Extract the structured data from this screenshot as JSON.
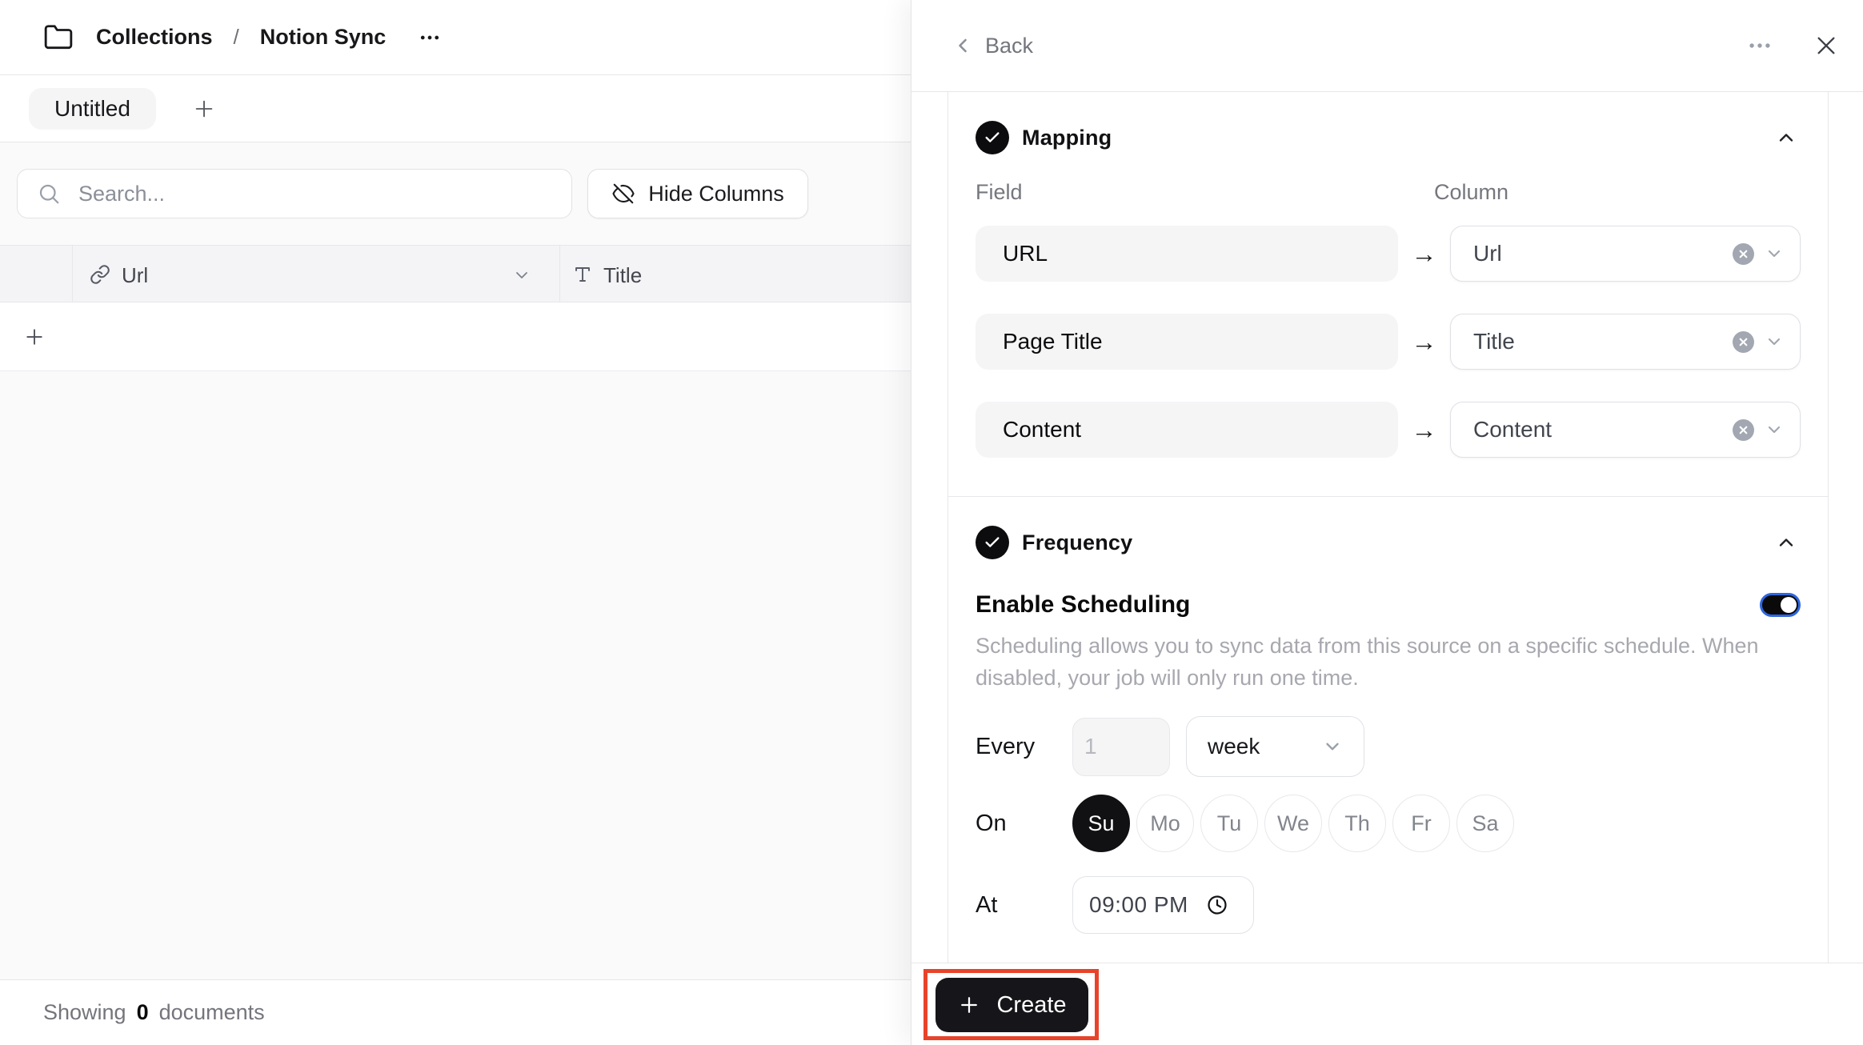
{
  "breadcrumb": {
    "root": "Collections",
    "separator": "/",
    "current": "Notion Sync"
  },
  "tabs": {
    "active": "Untitled"
  },
  "toolbar": {
    "search_placeholder": "Search...",
    "hide_columns_label": "Hide Columns"
  },
  "table": {
    "columns": [
      {
        "label": "Url",
        "icon": "link-icon"
      },
      {
        "label": "Title",
        "icon": "type-icon"
      }
    ],
    "rows": [],
    "footer": {
      "prefix": "Showing",
      "count": "0",
      "suffix": "documents"
    }
  },
  "panel": {
    "back_label": "Back",
    "mapping": {
      "title": "Mapping",
      "field_header": "Field",
      "column_header": "Column",
      "arrow": "→",
      "rows": [
        {
          "field": "URL",
          "column": "Url"
        },
        {
          "field": "Page Title",
          "column": "Title"
        },
        {
          "field": "Content",
          "column": "Content"
        }
      ]
    },
    "frequency": {
      "title": "Frequency",
      "enable_label": "Enable Scheduling",
      "enabled": true,
      "description": "Scheduling allows you to sync data from this source on a specific schedule. When disabled, your job will only run one time.",
      "every_label": "Every",
      "interval_value": "1",
      "unit_value": "week",
      "on_label": "On",
      "days": [
        {
          "label": "Su",
          "selected": true
        },
        {
          "label": "Mo",
          "selected": false
        },
        {
          "label": "Tu",
          "selected": false
        },
        {
          "label": "We",
          "selected": false
        },
        {
          "label": "Th",
          "selected": false
        },
        {
          "label": "Fr",
          "selected": false
        },
        {
          "label": "Sa",
          "selected": false
        }
      ],
      "at_label": "At",
      "time_value": "09:00 PM"
    },
    "create_label": "Create"
  },
  "colors": {
    "annotation_red": "#e8432a",
    "toggle_ring_blue": "#2e66dd",
    "black_accent": "#111114",
    "border_gray": "#e7e7ea",
    "muted_text": "#a7a8af"
  },
  "icons": {
    "folder": "folder-icon",
    "ellipsis": "more-dots-icon",
    "plus": "plus-icon",
    "search": "search-icon",
    "eye_off": "hide-eye-icon",
    "link": "link-icon",
    "type": "type-icon",
    "chevron_down": "chevron-down-icon",
    "chevron_up": "chevron-up-icon",
    "chevron_left": "chevron-left-icon",
    "close": "close-icon",
    "check": "check-icon",
    "clear": "clear-x-circle-icon",
    "clock": "clock-icon"
  }
}
